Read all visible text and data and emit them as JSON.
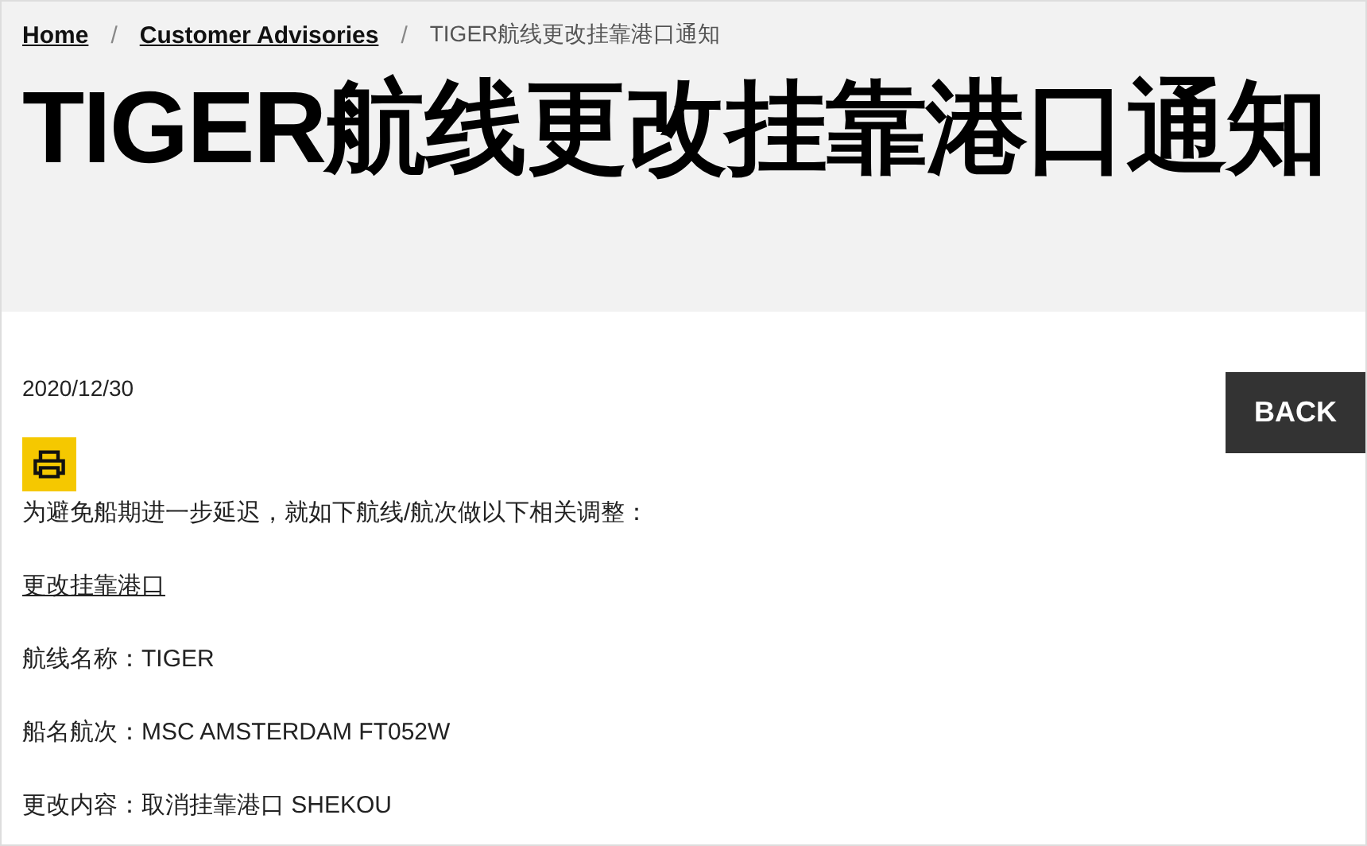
{
  "breadcrumb": [
    {
      "label": "Home",
      "kind": "link"
    },
    {
      "label": "/",
      "kind": "separator"
    },
    {
      "label": "Customer Advisories",
      "kind": "link"
    },
    {
      "label": "/",
      "kind": "separator"
    },
    {
      "label": "TIGER航线更改挂靠港口通知",
      "kind": "current"
    }
  ],
  "title": "TIGER航线更改挂靠港口通知",
  "date": "2020/12/30",
  "back_button": "BACK",
  "paragraphs": [
    {
      "text": "为避免船期进一步延迟，就如下航线/航次做以下相关调整：",
      "kind": "plain"
    },
    {
      "text": "更改挂靠港口",
      "kind": "link"
    },
    {
      "text": "航线名称：TIGER",
      "kind": "plain"
    },
    {
      "text": "船名航次：MSC AMSTERDAM FT052W",
      "kind": "plain"
    },
    {
      "text": "更改内容：取消挂靠港口 SHEKOU",
      "kind": "plain"
    }
  ]
}
